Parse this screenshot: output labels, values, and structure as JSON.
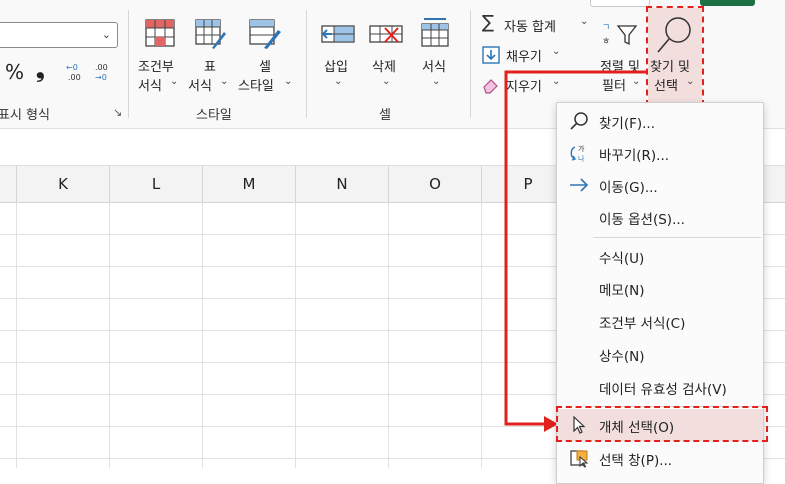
{
  "ribbon": {
    "number_group": {
      "percent_symbol": "%",
      "comma_symbol": "❟",
      "label": "표시 형식",
      "launcher_icon": "dialog-launcher-icon"
    },
    "style_group": {
      "conditional": {
        "line1": "조건부",
        "line2": "서식",
        "icon": "conditional-format-icon"
      },
      "table": {
        "line1": "표",
        "line2": "서식",
        "icon": "format-as-table-icon"
      },
      "cell": {
        "line1": "셀",
        "line2": "스타일",
        "icon": "cell-styles-icon"
      },
      "label": "스타일"
    },
    "cells_group": {
      "insert": {
        "label": "삽입",
        "icon": "insert-cells-icon"
      },
      "delete": {
        "label": "삭제",
        "icon": "delete-cells-icon"
      },
      "format": {
        "label": "서식",
        "icon": "format-cells-icon"
      },
      "label": "셀"
    },
    "editing_group": {
      "autosum": "자동 합계",
      "fill": "채우기",
      "clear": "지우기",
      "sort_filter": {
        "line1": "정렬 및",
        "line2": "필터"
      },
      "find_select": {
        "line1": "찾기 및",
        "line2": "선택"
      }
    }
  },
  "grid": {
    "columns": [
      "K",
      "L",
      "M",
      "N",
      "O",
      "P"
    ]
  },
  "menu": {
    "items": [
      {
        "label": "찾기(F)...",
        "mnemonic": "F",
        "icon": "search-icon"
      },
      {
        "label": "바꾸기(R)...",
        "mnemonic": "R",
        "icon": "replace-icon"
      },
      {
        "label": "이동(G)...",
        "mnemonic": "G",
        "icon": "arrow-right-icon"
      },
      {
        "label": "이동 옵션(S)...",
        "mnemonic": "S",
        "icon": ""
      },
      {
        "label": "수식(U)",
        "mnemonic": "U",
        "icon": ""
      },
      {
        "label": "메모(N)",
        "mnemonic": "N",
        "icon": ""
      },
      {
        "label": "조건부 서식(C)",
        "mnemonic": "C",
        "icon": ""
      },
      {
        "label": "상수(N)",
        "mnemonic": "N",
        "icon": ""
      },
      {
        "label": "데이터 유효성 검사(V)",
        "mnemonic": "V",
        "icon": ""
      },
      {
        "label": "개체 선택(O)",
        "mnemonic": "O",
        "icon": "pointer-icon"
      },
      {
        "label": "선택 창(P)...",
        "mnemonic": "P",
        "icon": "selection-pane-icon"
      }
    ]
  },
  "colors": {
    "annotation_red": "#e2211c",
    "highlight_bg": "#f3dede",
    "accent_blue": "#2e75b6"
  }
}
